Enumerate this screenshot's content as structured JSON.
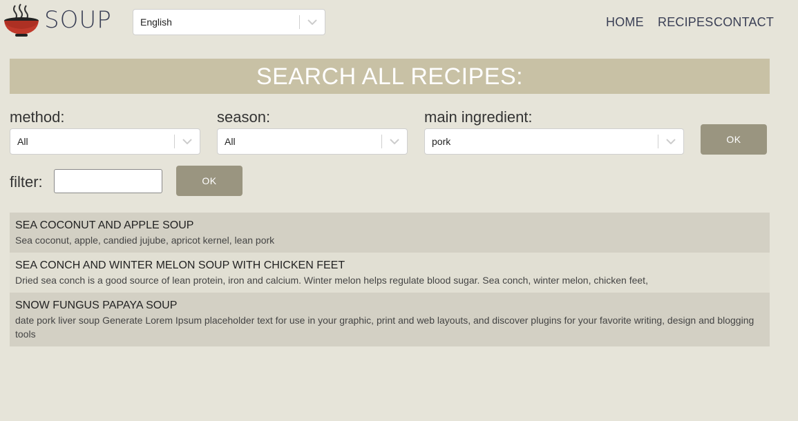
{
  "header": {
    "logo_text": "SOUP",
    "language": {
      "selected": "English"
    },
    "nav": [
      "HOME",
      "RECIPES",
      "CONTACT"
    ]
  },
  "search": {
    "banner": "SEARCH ALL RECIPES:",
    "method": {
      "label": "method:",
      "selected": "All"
    },
    "season": {
      "label": "season:",
      "selected": "All"
    },
    "ingredient": {
      "label": "main ingredient:",
      "selected": "pork"
    },
    "ok_label": "OK",
    "filter": {
      "label": "filter:",
      "value": "",
      "ok_label": "OK"
    }
  },
  "results": [
    {
      "title": "SEA COCONUT AND APPLE SOUP",
      "desc": "Sea coconut, apple, candied jujube, apricot kernel, lean pork"
    },
    {
      "title": "SEA CONCH AND WINTER MELON SOUP WITH CHICKEN FEET",
      "desc": "Dried sea conch is a good source of lean protein, iron and calcium. Winter melon helps regulate blood sugar. Sea conch, winter melon, chicken feet,"
    },
    {
      "title": "SNOW FUNGUS PAPAYA SOUP",
      "desc": "date pork liver soup Generate Lorem Ipsum placeholder text for use in your graphic, print and web layouts, and discover plugins for your favorite writing, design and blogging tools"
    }
  ],
  "icons": {
    "logo": "soup-bowl-icon",
    "dropdown": "chevron-down-icon"
  },
  "colors": {
    "background": "#e6e4d9",
    "banner": "#c8c1a5",
    "button": "#9a9580",
    "row_odd": "#d3d0c4",
    "row_even": "#e1dfd3",
    "bowl": "#c0392b",
    "text_dark": "#3a3f55"
  }
}
